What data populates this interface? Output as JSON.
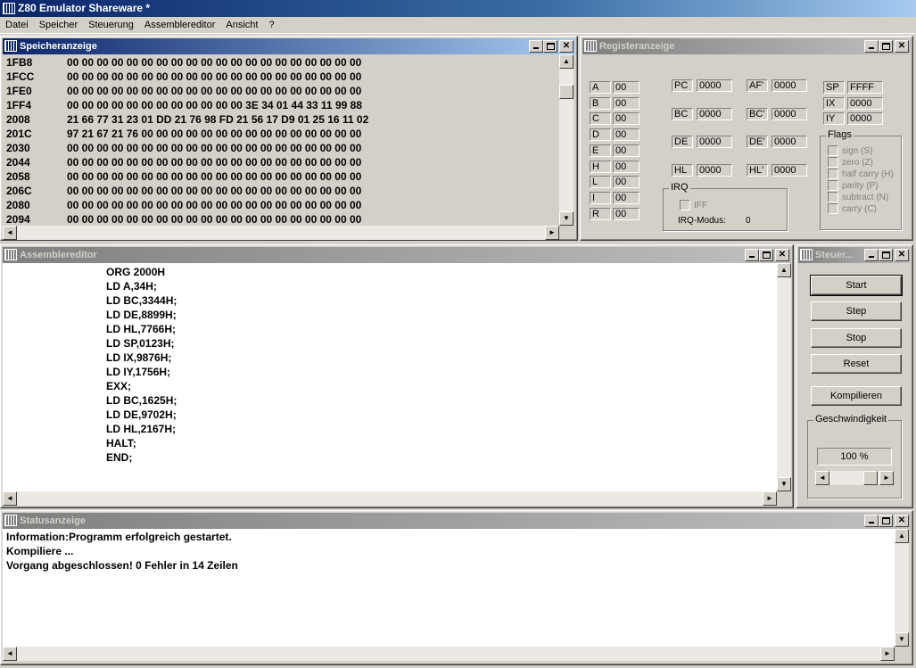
{
  "app": {
    "title": "Z80 Emulator Shareware *"
  },
  "menu": [
    "Datei",
    "Speicher",
    "Steuerung",
    "Assemblereditor",
    "Ansicht",
    "?"
  ],
  "memory": {
    "title": "Speicheranzeige",
    "rows": [
      {
        "addr": "1FB8",
        "bytes": "00 00 00 00 00 00 00 00 00 00 00 00 00 00 00 00 00 00 00 00"
      },
      {
        "addr": "1FCC",
        "bytes": "00 00 00 00 00 00 00 00 00 00 00 00 00 00 00 00 00 00 00 00"
      },
      {
        "addr": "1FE0",
        "bytes": "00 00 00 00 00 00 00 00 00 00 00 00 00 00 00 00 00 00 00 00"
      },
      {
        "addr": "1FF4",
        "bytes": "00 00 00 00 00 00 00 00 00 00 00 00 3E 34 01 44 33 11 99 88"
      },
      {
        "addr": "2008",
        "bytes": "21 66 77 31 23 01 DD 21 76 98 FD 21 56 17 D9 01 25 16 11 02"
      },
      {
        "addr": "201C",
        "bytes": "97 21 67 21 76 00 00 00 00 00 00 00 00 00 00 00 00 00 00 00"
      },
      {
        "addr": "2030",
        "bytes": "00 00 00 00 00 00 00 00 00 00 00 00 00 00 00 00 00 00 00 00"
      },
      {
        "addr": "2044",
        "bytes": "00 00 00 00 00 00 00 00 00 00 00 00 00 00 00 00 00 00 00 00"
      },
      {
        "addr": "2058",
        "bytes": "00 00 00 00 00 00 00 00 00 00 00 00 00 00 00 00 00 00 00 00"
      },
      {
        "addr": "206C",
        "bytes": "00 00 00 00 00 00 00 00 00 00 00 00 00 00 00 00 00 00 00 00"
      },
      {
        "addr": "2080",
        "bytes": "00 00 00 00 00 00 00 00 00 00 00 00 00 00 00 00 00 00 00 00"
      },
      {
        "addr": "2094",
        "bytes": "00 00 00 00 00 00 00 00 00 00 00 00 00 00 00 00 00 00 00 00"
      }
    ]
  },
  "registers": {
    "title": "Registeranzeige",
    "left": [
      {
        "name": "A",
        "value": "00"
      },
      {
        "name": "B",
        "value": "00"
      },
      {
        "name": "C",
        "value": "00"
      },
      {
        "name": "D",
        "value": "00"
      },
      {
        "name": "E",
        "value": "00"
      },
      {
        "name": "H",
        "value": "00"
      },
      {
        "name": "L",
        "value": "00"
      },
      {
        "name": "I",
        "value": "00"
      },
      {
        "name": "R",
        "value": "00"
      }
    ],
    "pairs": [
      {
        "name": "PC",
        "value": "0000"
      },
      {
        "name": "AF'",
        "value": "0000"
      },
      {
        "name": "BC",
        "value": "0000"
      },
      {
        "name": "BC'",
        "value": "0000"
      },
      {
        "name": "DE",
        "value": "0000"
      },
      {
        "name": "DE'",
        "value": "0000"
      },
      {
        "name": "HL",
        "value": "0000"
      },
      {
        "name": "HL'",
        "value": "0000"
      }
    ],
    "special": [
      {
        "name": "SP",
        "value": "FFFF"
      },
      {
        "name": "IX",
        "value": "0000"
      },
      {
        "name": "IY",
        "value": "0000"
      }
    ],
    "irq": {
      "title": "IRQ",
      "iff_label": "IFF",
      "mode_label": "IRQ-Modus:",
      "mode_value": "0"
    },
    "flags": {
      "title": "Flags",
      "items": [
        "sign (S)",
        "zero (Z)",
        "half carry (H)",
        "parity (P)",
        "subtract (N)",
        "carry (C)"
      ]
    }
  },
  "editor": {
    "title": "Assemblereditor",
    "lines": [
      "ORG 2000H",
      "LD A,34H;",
      "LD BC,3344H;",
      "LD DE,8899H;",
      "LD HL,7766H;",
      "LD SP,0123H;",
      "LD IX,9876H;",
      "LD IY,1756H;",
      "EXX;",
      "LD BC,1625H;",
      "LD DE,9702H;",
      "LD HL,2167H;",
      "HALT;",
      "END;"
    ]
  },
  "control": {
    "title": "Steuer...",
    "buttons": {
      "start": "Start",
      "step": "Step",
      "stop": "Stop",
      "reset": "Reset",
      "compile": "Kompilieren"
    },
    "speed": {
      "title": "Geschwindigkeit",
      "value": "100 %"
    }
  },
  "status": {
    "title": "Statusanzeige",
    "lines": [
      "Information:Programm erfolgreich gestartet.",
      "Kompiliere ...",
      "Vorgang abgeschlossen! 0 Fehler in 14 Zeilen"
    ]
  }
}
